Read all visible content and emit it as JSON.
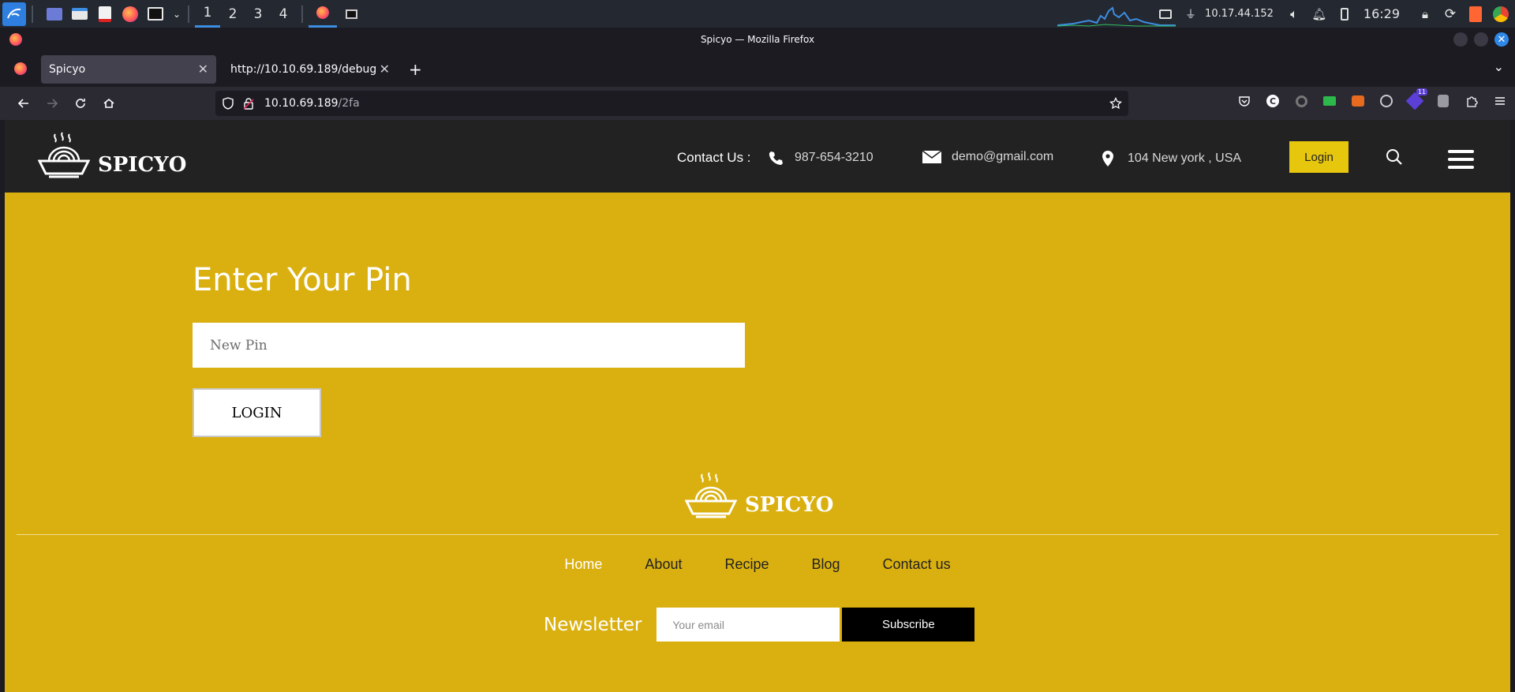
{
  "taskbar": {
    "workspaces": [
      "1",
      "2",
      "3",
      "4"
    ],
    "active_workspace": "1",
    "ip": "10.17.44.152",
    "clock": "16:29"
  },
  "window": {
    "title": "Spicyo — Mozilla Firefox"
  },
  "tabs": [
    {
      "label": "Spicyo",
      "active": true
    },
    {
      "label": "http://10.10.69.189/debug",
      "active": false
    }
  ],
  "urlbar": {
    "host": "10.10.69.189",
    "path": "/2fa"
  },
  "extensions": {
    "badge": "11"
  },
  "site": {
    "brand": "SPICYO",
    "contact_label": "Contact Us :",
    "phone": "987-654-3210",
    "email": "demo@gmail.com",
    "address": "104 New york , USA",
    "login_label": "Login"
  },
  "form": {
    "title": "Enter Your Pin",
    "pin_placeholder": "New Pin",
    "login_button": "LOGIN"
  },
  "footer": {
    "brand": "SPICYO",
    "nav": [
      {
        "label": "Home",
        "active": true
      },
      {
        "label": "About",
        "active": false
      },
      {
        "label": "Recipe",
        "active": false
      },
      {
        "label": "Blog",
        "active": false
      },
      {
        "label": "Contact us",
        "active": false
      }
    ],
    "newsletter_label": "Newsletter",
    "email_placeholder": "Your email",
    "subscribe_label": "Subscribe"
  },
  "colors": {
    "page_bg": "#dab010",
    "header_bg": "#222222",
    "login_btn_bg": "#e7c70e",
    "accent_blue": "#3d8de0"
  }
}
